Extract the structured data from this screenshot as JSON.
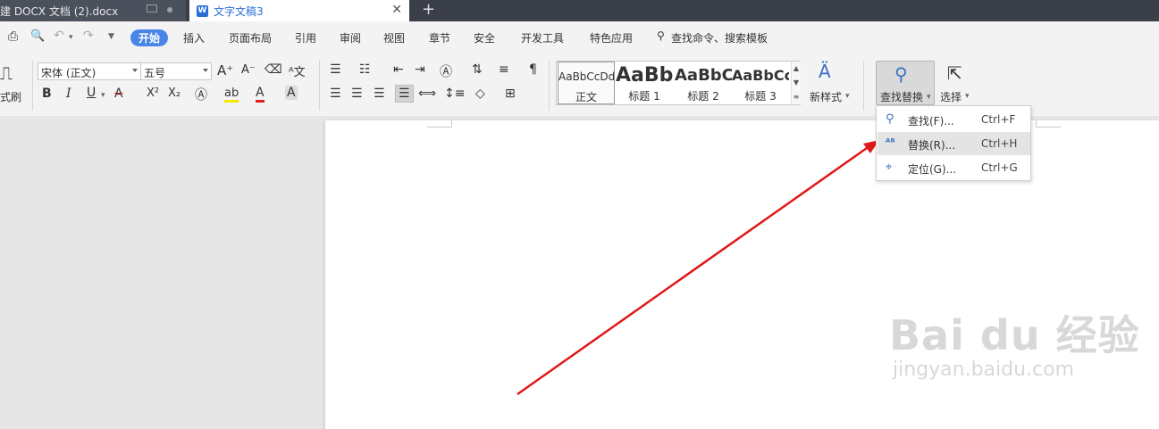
{
  "tabs": {
    "tab1_title": "建 DOCX 文档 (2).docx",
    "tab2_title": "文字文稿3",
    "tab2_icon": "W",
    "new_tab": "+"
  },
  "menu": {
    "items": [
      "开始",
      "插入",
      "页面布局",
      "引用",
      "审阅",
      "视图",
      "章节",
      "安全",
      "开发工具",
      "特色应用"
    ],
    "search_label": "查找命令、搜索模板"
  },
  "ribbon": {
    "format_painter": "式刷",
    "font_name": "宋体 (正文)",
    "font_size": "五号",
    "bold": "B",
    "italic": "I",
    "underline": "U",
    "styles": [
      {
        "preview": "AaBbCcDd",
        "name": "正文"
      },
      {
        "preview": "AaBb",
        "name": "标题 1"
      },
      {
        "preview": "AaBbC",
        "name": "标题 2"
      },
      {
        "preview": "AaBbCc",
        "name": "标题 3"
      }
    ],
    "new_style": "新样式",
    "find_replace": "查找替换",
    "select": "选择"
  },
  "dropdown": {
    "items": [
      {
        "label": "查找(F)...",
        "shortcut": "Ctrl+F"
      },
      {
        "label": "替换(R)...",
        "shortcut": "Ctrl+H"
      },
      {
        "label": "定位(G)...",
        "shortcut": "Ctrl+G"
      }
    ]
  },
  "watermark": {
    "brand": "Bai du 经验",
    "url": "jingyan.baidu.com"
  },
  "colors": {
    "accent": "#4a86e8",
    "arrow": "#e01818",
    "tab_active_text": "#2a6fd6"
  }
}
